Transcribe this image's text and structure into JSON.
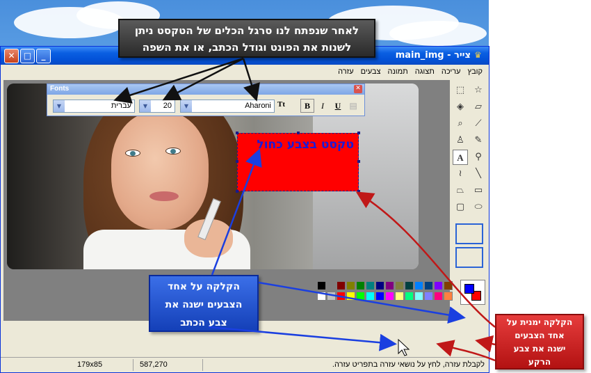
{
  "window": {
    "title": "צייר - main_img",
    "menu": [
      "קובץ",
      "עריכה",
      "תצוגה",
      "תמונה",
      "צבעים",
      "עזרה"
    ]
  },
  "fonts_toolbar": {
    "title": "Fonts",
    "font_name": "Aharoni",
    "font_size": "20",
    "script": "עברית",
    "bold_label": "B",
    "italic_label": "I",
    "underline_label": "U"
  },
  "canvas": {
    "text_content": "טקסט בצבע כחול",
    "text_color": "#1a1ad8",
    "text_background": "#ff0000"
  },
  "palette": {
    "top_row": [
      "#000000",
      "#808080",
      "#800000",
      "#808000",
      "#008000",
      "#008080",
      "#000080",
      "#800080",
      "#808040",
      "#004040",
      "#0080ff",
      "#004080",
      "#8000ff",
      "#804000"
    ],
    "bottom_row": [
      "#ffffff",
      "#c0c0c0",
      "#ff0000",
      "#ffff00",
      "#00ff00",
      "#00ffff",
      "#0000ff",
      "#ff00ff",
      "#ffff80",
      "#00ff80",
      "#80ffff",
      "#8080ff",
      "#ff0080",
      "#ff8040"
    ],
    "foreground": "#0000ff",
    "background": "#ff0000"
  },
  "statusbar": {
    "help": "לקבלת עזרה, לחץ על נושאי עזרה בתפריט עזרה.",
    "position": "587,270",
    "size": "179x85"
  },
  "callouts": {
    "top_line1": "לאחר שנפתח לנו סרגל הכלים של הטקסט ניתן",
    "top_line2": "לשנות את הפונט וגודל הכתב, או את השפה",
    "blue_line1": "הקלקה על אחד",
    "blue_line2": "הצבעים ישנה את",
    "blue_line3": "צבע הכתב",
    "red_line1": "הקלקה ימנית על",
    "red_line2": "אחד הצבעים",
    "red_line3": "ישנה את צבע",
    "red_line4": "הרקע"
  },
  "tools": [
    "select-free-icon",
    "select-rect-icon",
    "eraser-icon",
    "fill-icon",
    "picker-icon",
    "magnifier-icon",
    "pencil-icon",
    "brush-icon",
    "airbrush-icon",
    "text-icon",
    "line-icon",
    "curve-icon",
    "rectangle-icon",
    "polygon-icon",
    "ellipse-icon",
    "rounded-rect-icon"
  ]
}
